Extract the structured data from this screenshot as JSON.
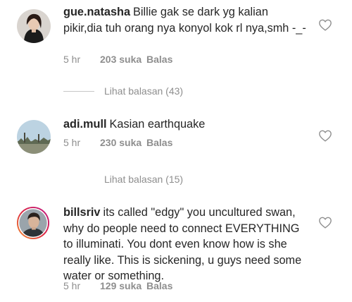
{
  "comments": [
    {
      "username": "gue.natasha",
      "text": "Billie gak se dark yg kalian pikir,dia tuh orang nya konyol kok rl nya,smh -_-",
      "time": "5 hr",
      "likes": "203 suka",
      "reply": "Balas",
      "avatar_icon": "woman-portrait-avatar"
    },
    {
      "username": "adi.mull",
      "text": "Kasian earthquake",
      "time": "5 hr",
      "likes": "230 suka",
      "reply": "Balas",
      "avatar_icon": "landscape-avatar"
    },
    {
      "username": "billsriv",
      "text": "its called \"edgy\" you uncultured swan, why do people need to connect EVERYTHING to illuminati. You dont even know how is she really like. This is sickening, u guys need some water or something.",
      "time": "5 hr",
      "likes": "129 suka",
      "reply": "Balas",
      "avatar_icon": "man-portrait-avatar"
    }
  ],
  "view_replies": [
    {
      "label": "Lihat balasan (43)"
    },
    {
      "label": "Lihat balasan (15)"
    }
  ],
  "colors": {
    "text": "#262626",
    "meta": "#8e8e8e",
    "story_ring_start": "#f09433",
    "story_ring_end": "#bc1888"
  }
}
